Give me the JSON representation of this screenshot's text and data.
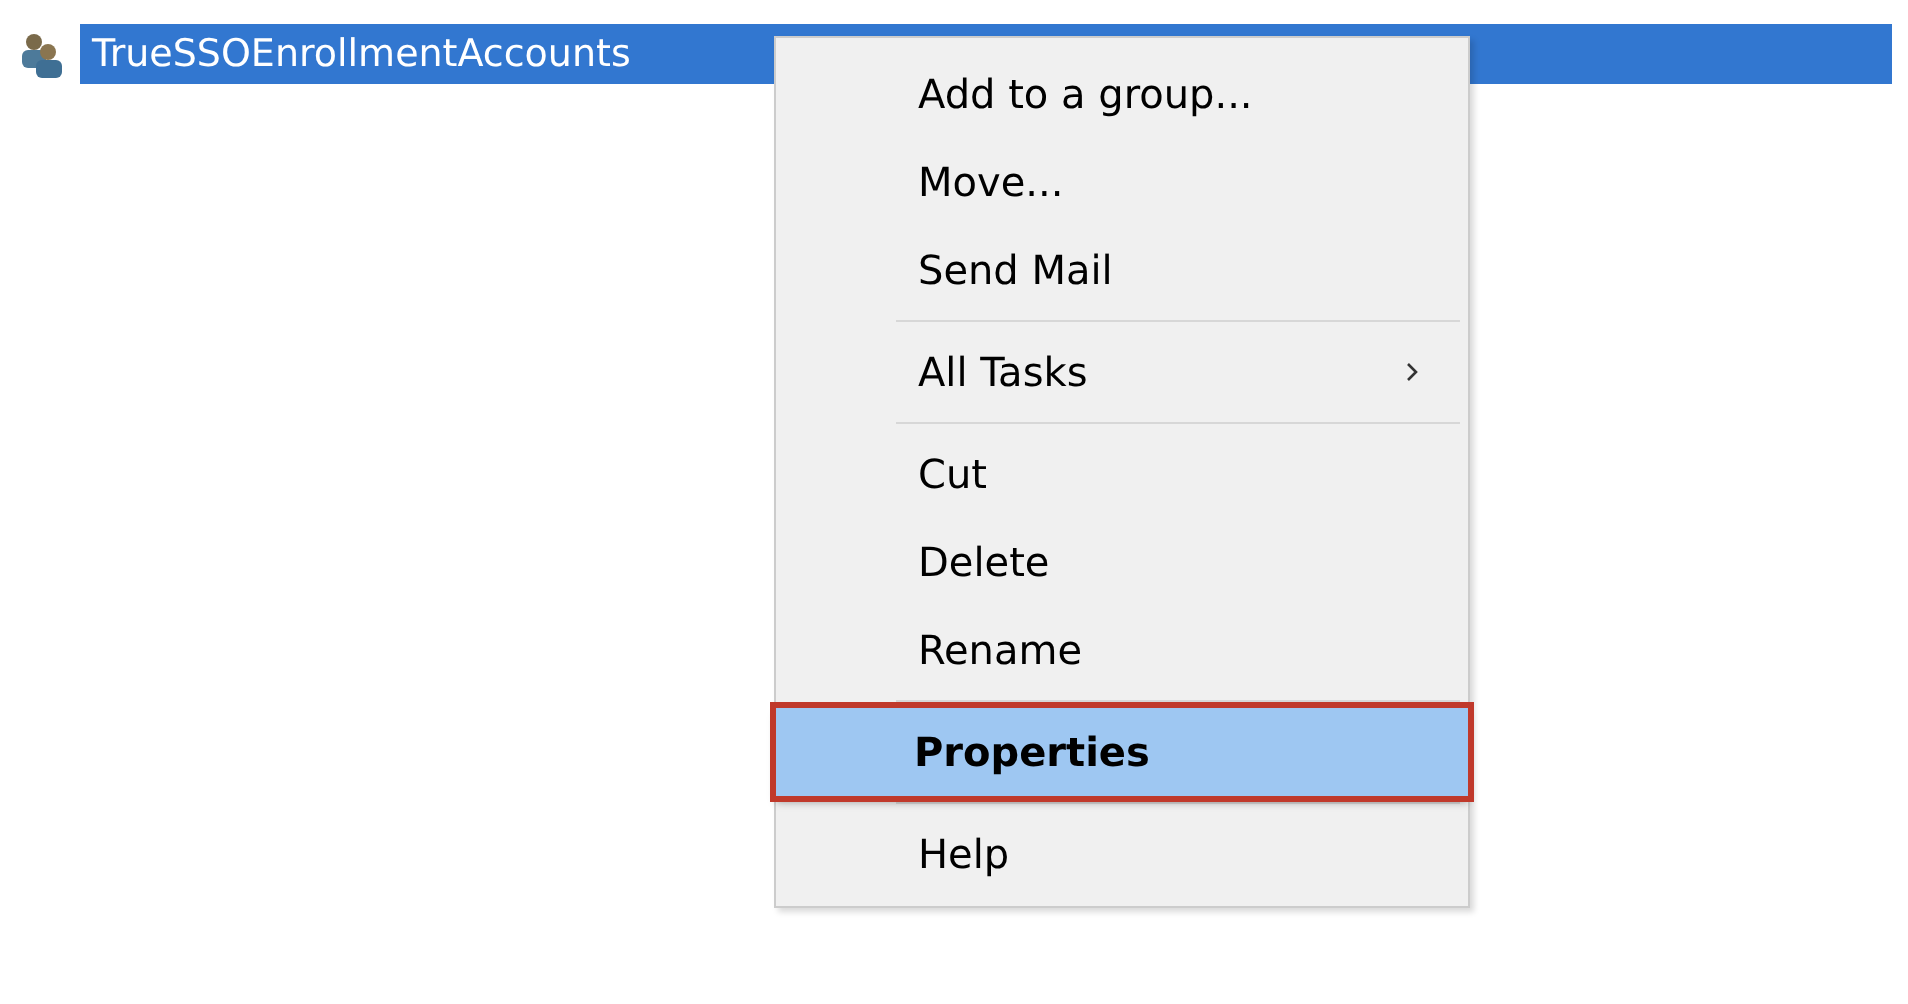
{
  "list_row": {
    "label": "TrueSSOEnrollmentAccounts",
    "selected": true
  },
  "context_menu": {
    "items": [
      {
        "kind": "item",
        "label": "Add to a group...",
        "selected": false,
        "submenu": false,
        "default": false
      },
      {
        "kind": "item",
        "label": "Move...",
        "selected": false,
        "submenu": false,
        "default": false
      },
      {
        "kind": "item",
        "label": "Send Mail",
        "selected": false,
        "submenu": false,
        "default": false
      },
      {
        "kind": "separator"
      },
      {
        "kind": "item",
        "label": "All Tasks",
        "selected": false,
        "submenu": true,
        "default": false
      },
      {
        "kind": "separator"
      },
      {
        "kind": "item",
        "label": "Cut",
        "selected": false,
        "submenu": false,
        "default": false
      },
      {
        "kind": "item",
        "label": "Delete",
        "selected": false,
        "submenu": false,
        "default": false
      },
      {
        "kind": "item",
        "label": "Rename",
        "selected": false,
        "submenu": false,
        "default": false
      },
      {
        "kind": "separator"
      },
      {
        "kind": "item",
        "label": "Properties",
        "selected": true,
        "submenu": false,
        "default": true
      },
      {
        "kind": "separator"
      },
      {
        "kind": "item",
        "label": "Help",
        "selected": false,
        "submenu": false,
        "default": false
      }
    ]
  }
}
